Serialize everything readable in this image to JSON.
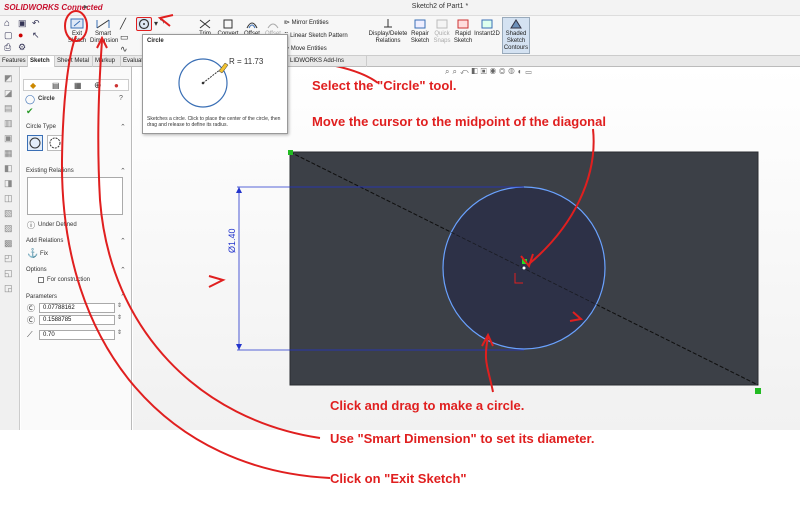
{
  "app": {
    "brand": "SOLIDWORKS Connected",
    "document_title": "Sketch2 of Part1 *"
  },
  "toolbar": {
    "exit_sketch": "Exit Sketch",
    "smart_dimension": "Smart Dimension",
    "trim": "Trim",
    "convert": "Convert",
    "offset": "Offset",
    "offset2": "Offset",
    "mirror_entities": "Mirror Entities",
    "linear_sketch_pattern": "Linear Sketch Pattern",
    "move_entities": "Move Entities",
    "display_delete_relations": "Display/Delete Relations",
    "repair_sketch": "Repair Sketch",
    "quick_snaps": "Quick Snaps",
    "rapid_sketch": "Rapid Sketch",
    "instant2d": "Instant2D",
    "shaded_sketch_contours": "Shaded Sketch Contours",
    "accent": "#1f6fc8"
  },
  "tabs": [
    {
      "label": "Features"
    },
    {
      "label": "Sketch",
      "active": true
    },
    {
      "label": "Sheet Metal"
    },
    {
      "label": "Markup"
    },
    {
      "label": "Evaluat"
    },
    {
      "label": "LIDWORKS Add-Ins"
    }
  ],
  "tooltip": {
    "title": "Circle",
    "radius_label": "R = 11.73",
    "description": "Sketches a circle. Click to place the center of the circle, then drag and release to define its radius."
  },
  "property_manager": {
    "title": "Circle",
    "circle_type_label": "Circle Type",
    "existing_relations_label": "Existing Relations",
    "status": "Under Defined",
    "add_relations_label": "Add Relations",
    "fix_label": "Fix",
    "options_label": "Options",
    "for_construction": "For construction",
    "parameters_label": "Parameters",
    "param_x": "0.07788162",
    "param_y": "0.1588785",
    "param_r": "0.70"
  },
  "canvas": {
    "dimension_text": "Ø1.40"
  },
  "annotations": {
    "select_circle": "Select the \"Circle\" tool.",
    "move_cursor": "Move the cursor to the midpoint of the diagonal",
    "click_drag": "Click and drag to make a circle.",
    "smart_dimension": "Use \"Smart Dimension\" to set its diameter.",
    "exit_sketch": "Click on \"Exit Sketch\"",
    "color": "#e01f1f"
  }
}
